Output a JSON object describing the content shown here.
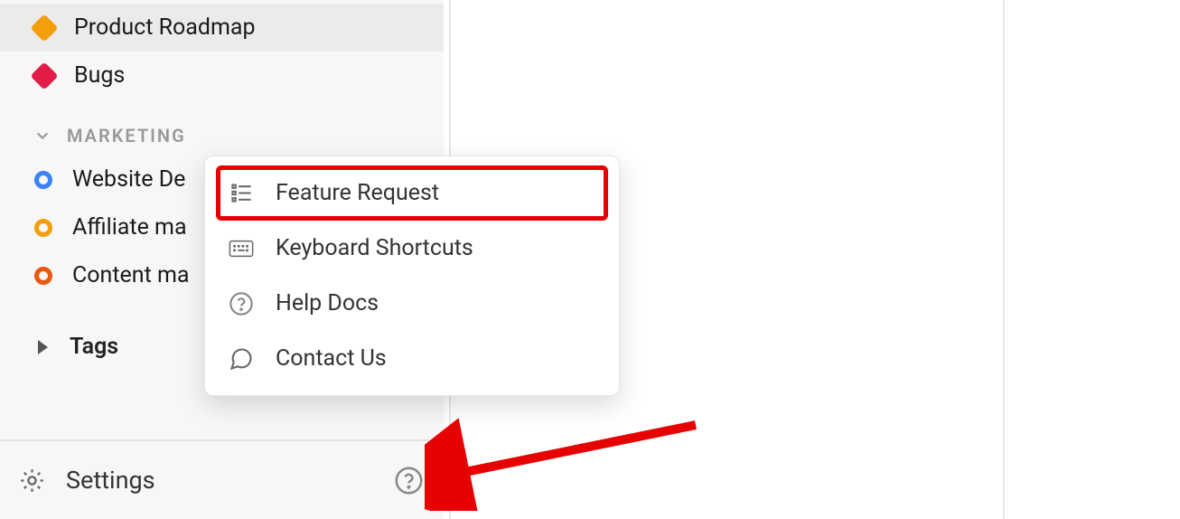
{
  "sidebar": {
    "items": [
      {
        "label": "Product Roadmap",
        "icon_color": "orange",
        "active": true
      },
      {
        "label": "Bugs",
        "icon_color": "red",
        "active": false
      }
    ],
    "section_label": "MARKETING",
    "marketing_items": [
      {
        "label": "Website De",
        "circle": "blue"
      },
      {
        "label": "Affiliate ma",
        "circle": "orange"
      },
      {
        "label": "Content ma",
        "circle": "darkorange"
      }
    ],
    "tags_label": "Tags"
  },
  "footer": {
    "settings_label": "Settings"
  },
  "popup": {
    "items": [
      {
        "label": "Feature Request",
        "icon": "list",
        "highlighted": true
      },
      {
        "label": "Keyboard Shortcuts",
        "icon": "keyboard",
        "highlighted": false
      },
      {
        "label": "Help Docs",
        "icon": "help-circle",
        "highlighted": false
      },
      {
        "label": "Contact Us",
        "icon": "chat",
        "highlighted": false
      }
    ]
  },
  "colors": {
    "highlight_red": "#e60000",
    "diamond_orange": "#f59e0b",
    "diamond_red": "#e11d48"
  }
}
